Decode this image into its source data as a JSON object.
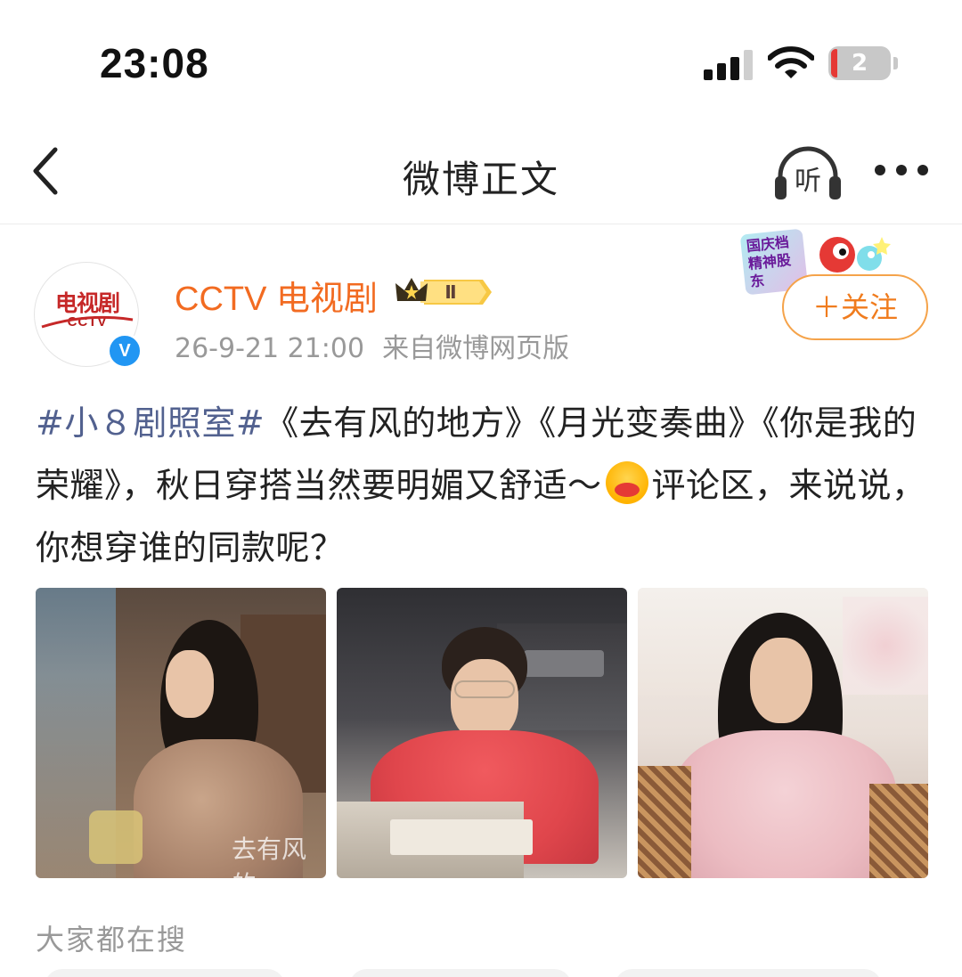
{
  "status_bar": {
    "time": "23:08",
    "battery_level": "2",
    "signal_bars": 3,
    "battery_color": "#e53935"
  },
  "nav": {
    "title": "微博正文",
    "listen_label": "听"
  },
  "post": {
    "username": "CCTV 电视剧",
    "username_color": "#f26b21",
    "avatar": {
      "text": "电视剧",
      "sub": "CCTV"
    },
    "verified_mark": "V",
    "badge_level": "Ⅱ",
    "timestamp": "26-9-21 21:00",
    "source": "来自微博网页版",
    "festival_badge": "国庆档 精神股东",
    "follow_label": "＋关注",
    "text": {
      "hashtag": "#小８剧照室#",
      "line_rest": "《去有风的地方》《月光变奏曲》《你是我的荣耀》，秋日穿搭当然要明媚又舒适～",
      "emoji": "hugging-face-emoji",
      "tail": "评论区，来说说，你想穿谁的同款呢？"
    },
    "images": [
      {
        "name": "photo-woman-floral-shirt",
        "caption": "去有风的"
      },
      {
        "name": "photo-man-red-sweater-phone",
        "caption": ""
      },
      {
        "name": "photo-woman-pink-sweater",
        "caption": ""
      }
    ]
  },
  "search": {
    "heading": "大家都在搜"
  },
  "colors": {
    "hashtag": "#52618f",
    "follow_border": "#f5a34a",
    "follow_text": "#f07c1e"
  }
}
